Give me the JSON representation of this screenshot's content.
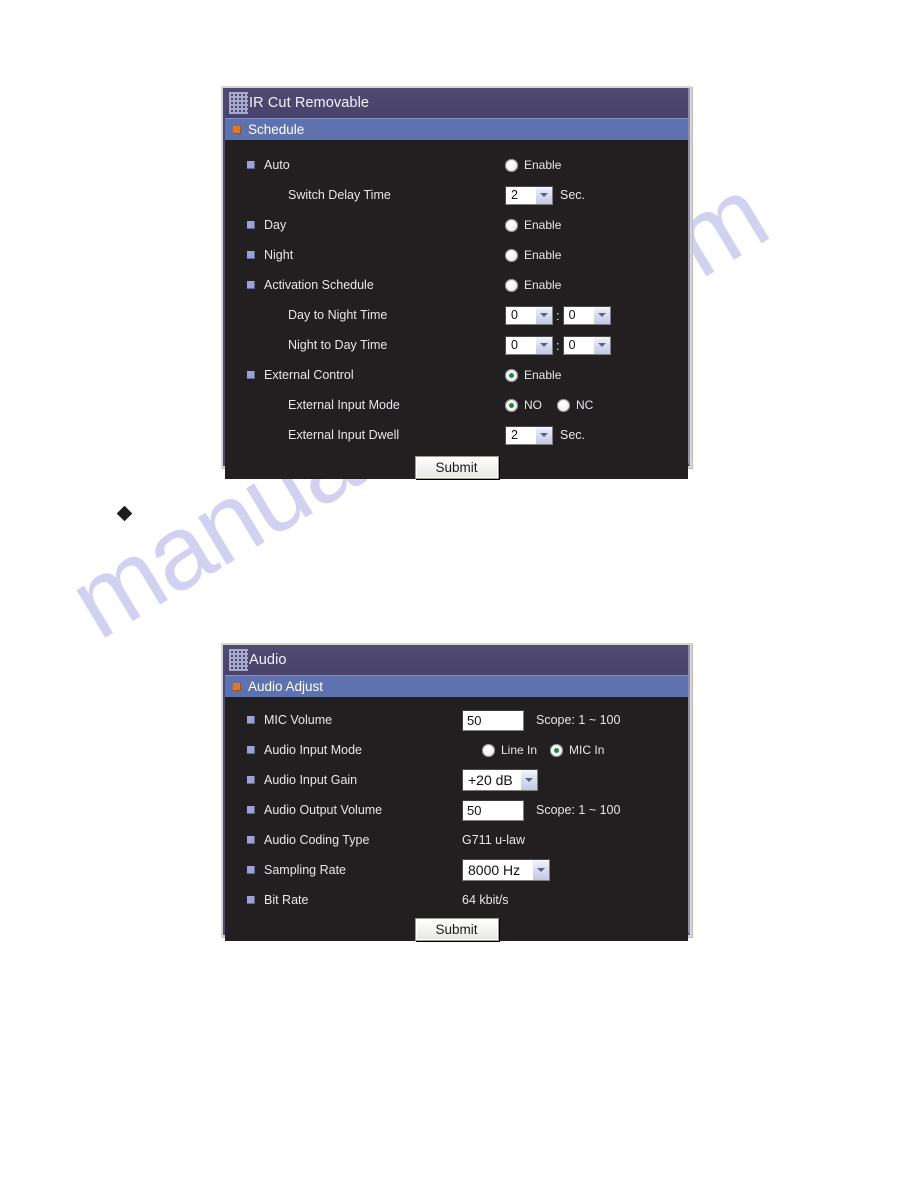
{
  "document": {
    "watermark": "manualshive.com",
    "bullet_marker": "◆"
  },
  "panels": [
    {
      "id": "ir-cut-removable",
      "title": "IR Cut Removable",
      "title_icon": "grid-icon",
      "section": {
        "label": "Schedule",
        "marker_color": "#e8761c"
      },
      "rows": [
        {
          "type": "radio-row",
          "label": "Auto",
          "radio_label": "Enable",
          "selected": false
        },
        {
          "type": "select-row",
          "label": "Switch Delay Time",
          "indent": true,
          "value": "2",
          "unit": "Sec."
        },
        {
          "type": "radio-row",
          "label": "Day",
          "radio_label": "Enable",
          "selected": false
        },
        {
          "type": "radio-row",
          "label": "Night",
          "radio_label": "Enable",
          "selected": false
        },
        {
          "type": "radio-row",
          "label": "Activation Schedule",
          "radio_label": "Enable",
          "selected": false
        },
        {
          "type": "time-row",
          "label": "Day to Night Time",
          "indent": true,
          "hour": "0",
          "minute": "0",
          "separator": ":"
        },
        {
          "type": "time-row",
          "label": "Night to Day Time",
          "indent": true,
          "hour": "0",
          "minute": "0",
          "separator": ":"
        },
        {
          "type": "radio-row",
          "label": "External Control",
          "radio_label": "Enable",
          "selected": true
        },
        {
          "type": "radio-pair-row",
          "label": "External Input Mode",
          "indent": true,
          "option_a": "NO",
          "option_a_selected": true,
          "option_b": "NC",
          "option_b_selected": false
        },
        {
          "type": "select-row",
          "label": "External Input Dwell",
          "indent": true,
          "value": "2",
          "unit": "Sec."
        }
      ],
      "submit_label": "Submit"
    },
    {
      "id": "audio",
      "title": "Audio",
      "title_icon": "grid-icon",
      "section": {
        "label": "Audio Adjust",
        "marker_color": "#e8761c"
      },
      "rows": [
        {
          "type": "text-row",
          "label": "MIC Volume",
          "value": "50",
          "hint": "Scope: 1 ~ 100"
        },
        {
          "type": "radio-pair-row",
          "label": "Audio Input Mode",
          "option_a": "Line In",
          "option_a_selected": false,
          "option_b": "MIC In",
          "option_b_selected": true
        },
        {
          "type": "select-row",
          "label": "Audio Input Gain",
          "value": "+20 dB",
          "unit": ""
        },
        {
          "type": "text-row",
          "label": "Audio Output Volume",
          "value": "50",
          "hint": "Scope: 1 ~ 100"
        },
        {
          "type": "static-row",
          "label": "Audio Coding Type",
          "value": "G711 u-law"
        },
        {
          "type": "select-row",
          "label": "Sampling Rate",
          "value": "8000 Hz",
          "unit": ""
        },
        {
          "type": "static-row",
          "label": "Bit Rate",
          "value": "64 kbit/s"
        }
      ],
      "submit_label": "Submit"
    }
  ],
  "theme": {
    "titlebar_bg": "#4c4670",
    "section_bg": "#5d72ae",
    "body_bg": "#211f20",
    "accent_orange": "#e8761c",
    "radio_on": "#1f8a35",
    "text": "#e7e7ea",
    "watermark_color": "#c9c9ef"
  }
}
